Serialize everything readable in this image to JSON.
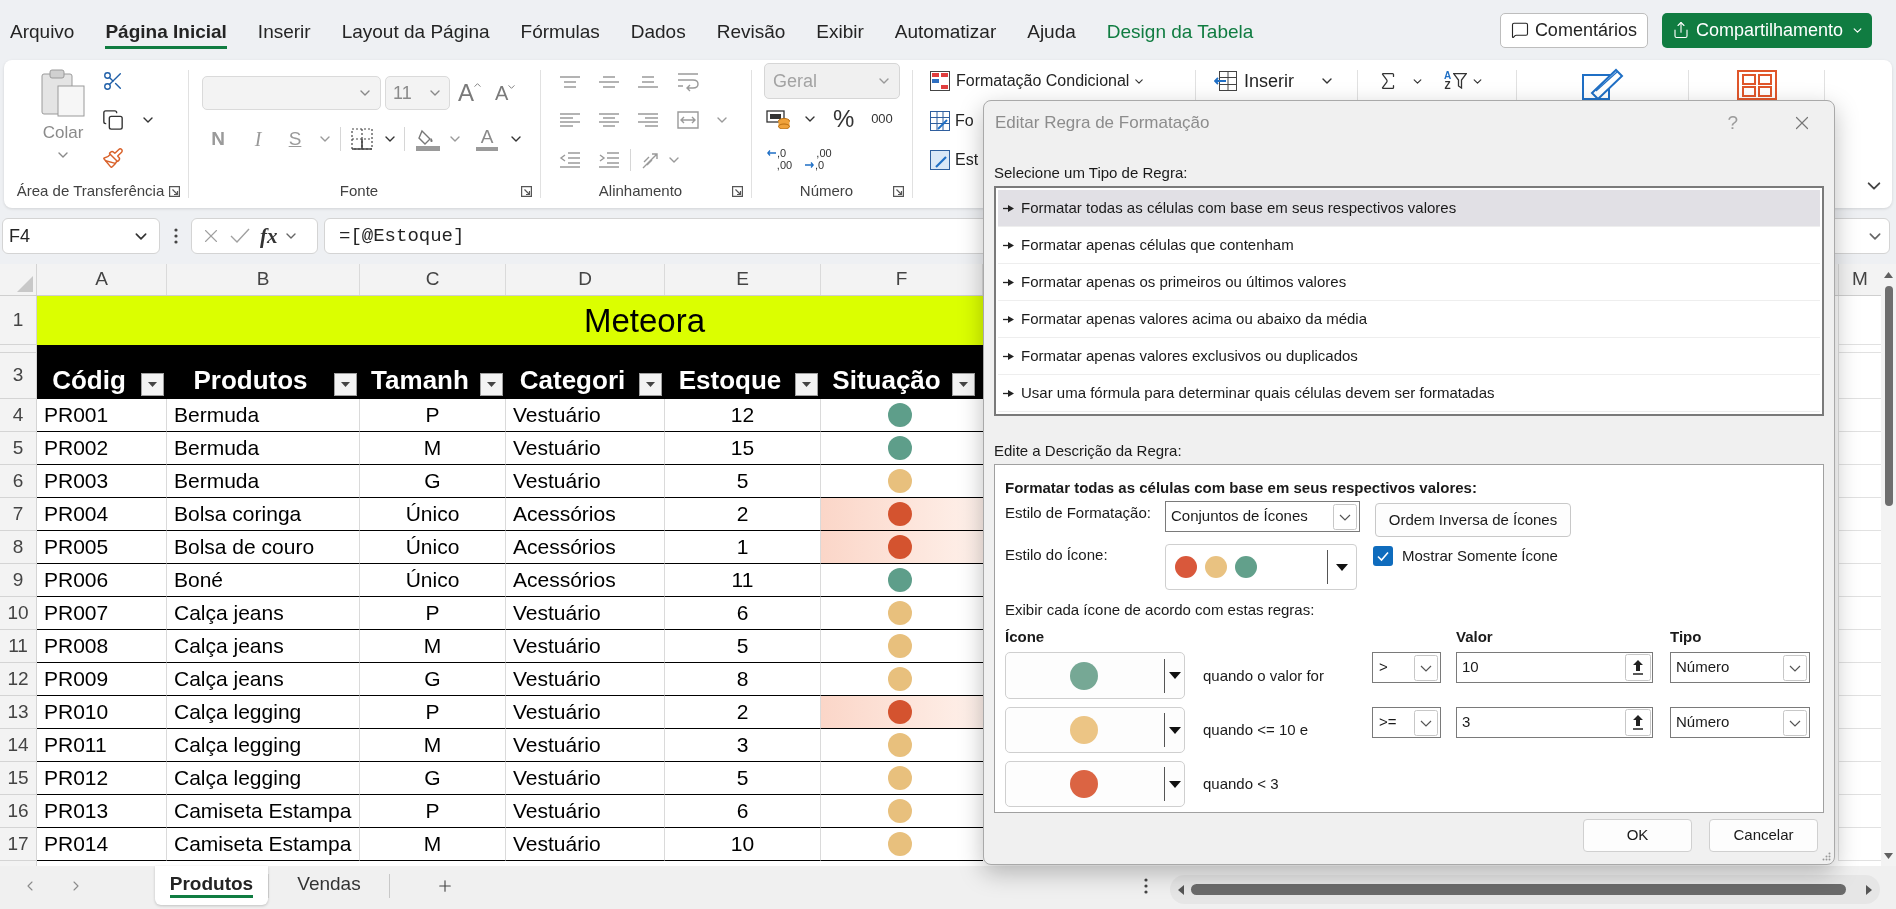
{
  "menu_tabs": [
    {
      "label": "Arquivo",
      "kind": "tab",
      "selected": false
    },
    {
      "label": "Página Inicial",
      "kind": "tab",
      "selected": true
    },
    {
      "label": "Inserir",
      "kind": "tab",
      "selected": false
    },
    {
      "label": "Layout da Página",
      "kind": "tab",
      "selected": false
    },
    {
      "label": "Fórmulas",
      "kind": "tab",
      "selected": false
    },
    {
      "label": "Dados",
      "kind": "tab",
      "selected": false
    },
    {
      "label": "Revisão",
      "kind": "tab",
      "selected": false
    },
    {
      "label": "Exibir",
      "kind": "tab",
      "selected": false
    },
    {
      "label": "Automatizar",
      "kind": "tab",
      "selected": false
    },
    {
      "label": "Ajuda",
      "kind": "tab",
      "selected": false
    },
    {
      "label": "Design da Tabela",
      "kind": "contextual",
      "selected": false
    }
  ],
  "header_buttons": {
    "comments": "Comentários",
    "share": "Compartilhamento"
  },
  "ribbon": {
    "clipboard": {
      "paste": "Colar",
      "label": "Área de Transferência"
    },
    "font": {
      "size": "11",
      "grow": "A",
      "shrink": "A",
      "bold": "N",
      "italic": "I",
      "underline": "S",
      "font_color": "A",
      "label": "Fonte"
    },
    "alignment": {
      "label": "Alinhamento"
    },
    "number": {
      "format": "Geral",
      "percent": "%",
      "thousands": "000",
      "increase_decimal": [
        ",0",
        ",00"
      ],
      "decrease_decimal": [
        ",00",
        ",0"
      ],
      "label": "Número"
    },
    "styles": {
      "conditional_formatting": "Formatação Condicional",
      "format_as_table": "Fo",
      "cell_styles": "Est"
    },
    "cells": {
      "insert": "Inserir"
    },
    "editing": {
      "sort_letters": [
        "A",
        "Z"
      ]
    }
  },
  "formula_bar": {
    "name_box": "F4",
    "function_label": "fx",
    "formula": "=[@Estoque]"
  },
  "sheet": {
    "column_letters": [
      "A",
      "B",
      "C",
      "D",
      "E",
      "F"
    ],
    "far_column_letter": "M",
    "title_row": {
      "number": "1",
      "text": "Meteora"
    },
    "header_row": {
      "number": "3",
      "cells": [
        "Códig",
        "Produtos",
        "Tamanh",
        "Categori",
        "Estoque",
        "Situação"
      ]
    },
    "rows": [
      {
        "number": "4",
        "cells": [
          "PR001",
          "Bermuda",
          "P",
          "Vestuário",
          "12"
        ],
        "color": "#5e9e8a",
        "highlighted": false
      },
      {
        "number": "5",
        "cells": [
          "PR002",
          "Bermuda",
          "M",
          "Vestuário",
          "15"
        ],
        "color": "#5e9e8a",
        "highlighted": false
      },
      {
        "number": "6",
        "cells": [
          "PR003",
          "Bermuda",
          "G",
          "Vestuário",
          "5"
        ],
        "color": "#e8c07d",
        "highlighted": false
      },
      {
        "number": "7",
        "cells": [
          "PR004",
          "Bolsa coringa",
          "Único",
          "Acessórios",
          "2"
        ],
        "color": "#d4532f",
        "highlighted": true
      },
      {
        "number": "8",
        "cells": [
          "PR005",
          "Bolsa de couro",
          "Único",
          "Acessórios",
          "1"
        ],
        "color": "#d4532f",
        "highlighted": true
      },
      {
        "number": "9",
        "cells": [
          "PR006",
          "Boné",
          "Único",
          "Acessórios",
          "11"
        ],
        "color": "#5e9e8a",
        "highlighted": false
      },
      {
        "number": "10",
        "cells": [
          "PR007",
          "Calça jeans",
          "P",
          "Vestuário",
          "6"
        ],
        "color": "#e8c07d",
        "highlighted": false
      },
      {
        "number": "11",
        "cells": [
          "PR008",
          "Calça jeans",
          "M",
          "Vestuário",
          "5"
        ],
        "color": "#e8c07d",
        "highlighted": false
      },
      {
        "number": "12",
        "cells": [
          "PR009",
          "Calça jeans",
          "G",
          "Vestuário",
          "8"
        ],
        "color": "#e8c07d",
        "highlighted": false
      },
      {
        "number": "13",
        "cells": [
          "PR010",
          "Calça legging",
          "P",
          "Vestuário",
          "2"
        ],
        "color": "#d4532f",
        "highlighted": true
      },
      {
        "number": "14",
        "cells": [
          "PR011",
          "Calça legging",
          "M",
          "Vestuário",
          "3"
        ],
        "color": "#e8c07d",
        "highlighted": false
      },
      {
        "number": "15",
        "cells": [
          "PR012",
          "Calça legging",
          "G",
          "Vestuário",
          "5"
        ],
        "color": "#e8c07d",
        "highlighted": false
      },
      {
        "number": "16",
        "cells": [
          "PR013",
          "Camiseta Estampa",
          "P",
          "Vestuário",
          "6"
        ],
        "color": "#e8c07d",
        "highlighted": false
      },
      {
        "number": "17",
        "cells": [
          "PR014",
          "Camiseta Estampa",
          "M",
          "Vestuário",
          "10"
        ],
        "color": "#e8c07d",
        "highlighted": false
      }
    ]
  },
  "sheet_tabs": [
    {
      "label": "Produtos",
      "selected": true
    },
    {
      "label": "Vendas",
      "selected": false
    }
  ],
  "dialog": {
    "title": "Editar Regra de Formatação",
    "help": "?",
    "rule_type_label": "Selecione um Tipo de Regra:",
    "rule_types": [
      {
        "label": "Formatar todas as células com base em seus respectivos valores",
        "selected": true
      },
      {
        "label": "Formatar apenas células que contenham",
        "selected": false
      },
      {
        "label": "Formatar apenas os primeiros ou últimos valores",
        "selected": false
      },
      {
        "label": "Formatar apenas valores acima ou abaixo da média",
        "selected": false
      },
      {
        "label": "Formatar apenas valores exclusivos ou duplicados",
        "selected": false
      },
      {
        "label": "Usar uma fórmula para determinar quais células devem ser formatadas",
        "selected": false
      }
    ],
    "description_label": "Edite a Descrição da Regra:",
    "description": {
      "heading": "Formatar todas as células com base em seus respectivos valores:",
      "format_style": {
        "label": "Estilo de Formatação:",
        "value": "Conjuntos de Ícones"
      },
      "reverse_button": "Ordem Inversa de Ícones",
      "icon_style": {
        "label": "Estilo do Ícone:",
        "dots": [
          {
            "color": "#d9583b"
          },
          {
            "color": "#e9c281"
          },
          {
            "color": "#62a08b"
          }
        ]
      },
      "show_icon_only": {
        "label": "Mostrar Somente Ícone",
        "checked": true
      },
      "rules_label": "Exibir cada ícone de acordo com estas regras:",
      "columns": {
        "icon": "Ícone",
        "value": "Valor",
        "type": "Tipo"
      },
      "rules": [
        {
          "color": "#76a895",
          "condition": "quando o valor for",
          "operator": ">",
          "value": "10",
          "type": "Número"
        },
        {
          "color": "#ecc585",
          "condition": "quando <= 10 e",
          "operator": ">=",
          "value": "3",
          "type": "Número"
        },
        {
          "color": "#db6443",
          "condition": "quando < 3"
        }
      ]
    },
    "buttons": {
      "ok": "OK",
      "cancel": "Cancelar"
    }
  }
}
